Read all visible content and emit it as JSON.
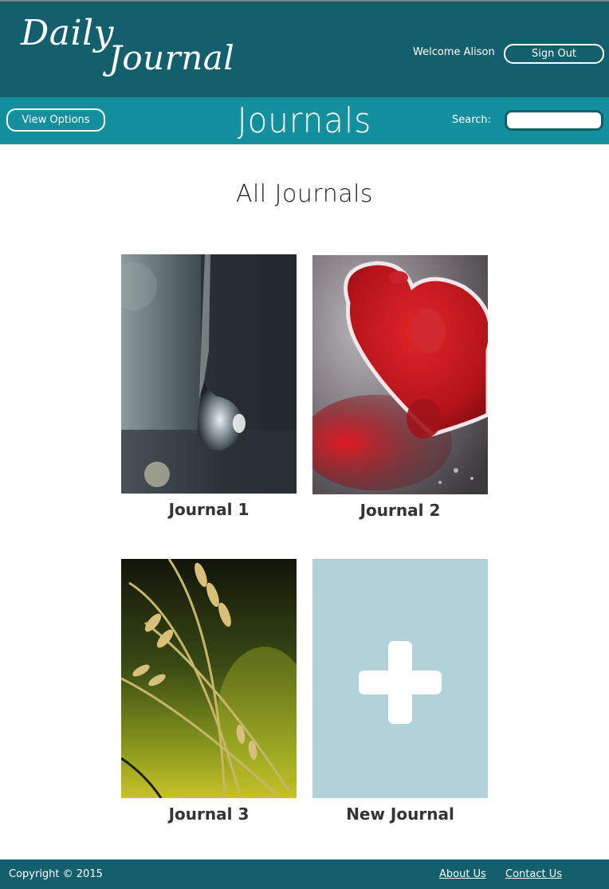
{
  "header": {
    "logo_line1": "Daily",
    "logo_line2": "Journal",
    "welcome_text": "Welcome Alison",
    "signout_label": "Sign Out"
  },
  "navbar": {
    "view_options_label": "View Options",
    "title": "Journals",
    "search_label": "Search:",
    "search_value": ""
  },
  "main": {
    "heading": "All Journals",
    "journals": [
      {
        "label": "Journal 1",
        "image": "water-drop-photo"
      },
      {
        "label": "Journal 2",
        "image": "red-heart-photo"
      },
      {
        "label": "Journal 3",
        "image": "wheat-grass-photo"
      },
      {
        "label": "New Journal",
        "image": "plus-icon"
      }
    ]
  },
  "footer": {
    "copyright": "Copyright © 2015",
    "about_label": "About Us",
    "contact_label": "Contact Us"
  },
  "colors": {
    "header_bg": "#135f6b",
    "navbar_bg": "#138f9d",
    "new_tile_bg": "#b0d2d8"
  }
}
